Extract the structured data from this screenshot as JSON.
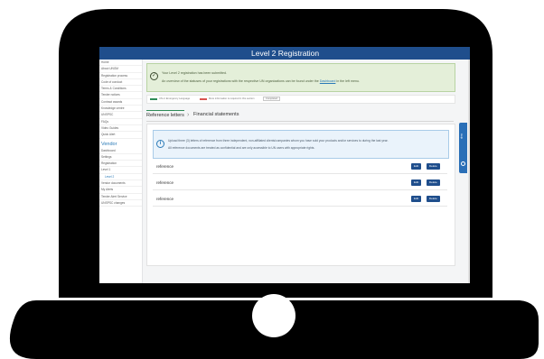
{
  "window": {
    "title": "Level 2 Registration"
  },
  "sidebar": {
    "items": [
      {
        "label": "Home"
      },
      {
        "label": "About UNGM"
      },
      {
        "label": "Registration process"
      },
      {
        "label": "Code of conduct"
      },
      {
        "label": "Terms & Conditions"
      },
      {
        "label": "Tender notices"
      },
      {
        "label": "Contract awards"
      },
      {
        "label": "Knowledge centre"
      },
      {
        "label": "UNSPSC"
      },
      {
        "label": "FAQs"
      },
      {
        "label": "Video Guides"
      },
      {
        "label": "Quick Alert"
      }
    ],
    "section_title": "Vendor",
    "vendor_items": [
      {
        "label": "Dashboard"
      },
      {
        "label": "Settings"
      },
      {
        "label": "Registration"
      },
      {
        "label": "Level 1"
      },
      {
        "label": "Level 2"
      },
      {
        "label": "Vendor documents"
      },
      {
        "label": "My Alerts"
      },
      {
        "label": "Tender Alert Service"
      },
      {
        "label": "UNSPSC changes"
      }
    ]
  },
  "success_alert": {
    "line1": "Your Level 2 registration has been submitted.",
    "line2_prefix": "An overview of the statuses of your registrations with the respective UN organizations can be found under the",
    "line2_link": "Dashboard",
    "line2_suffix": "in the left menu."
  },
  "legend": {
    "item1": "UN or Emergency Language",
    "item2": "More information is required in this section",
    "badge": "Completed"
  },
  "tabs": [
    {
      "label": "Reference letters"
    },
    {
      "label": "Financial statements"
    }
  ],
  "info_box": {
    "line1": "Upload three (3) letters of reference from three independent, non-affiliated clients/companies whom you have sold your products and/or services to during the last year.",
    "line2": "All reference documents are treated as confidential and are only accessible to UN users with appropriate rights."
  },
  "references": [
    {
      "name": "reference",
      "edit": "Edit",
      "delete": "Delete"
    },
    {
      "name": "reference",
      "edit": "Edit",
      "delete": "Delete"
    },
    {
      "name": "reference",
      "edit": "Edit",
      "delete": "Delete"
    }
  ],
  "help_tab": {
    "label": "Help"
  },
  "colors": {
    "header": "#1f4e8c",
    "success_bg": "#e4efd9",
    "info_bg": "#eaf3fb",
    "accent_green": "#2e8b57",
    "accent_red": "#d9534f",
    "laptop": "#000000"
  }
}
